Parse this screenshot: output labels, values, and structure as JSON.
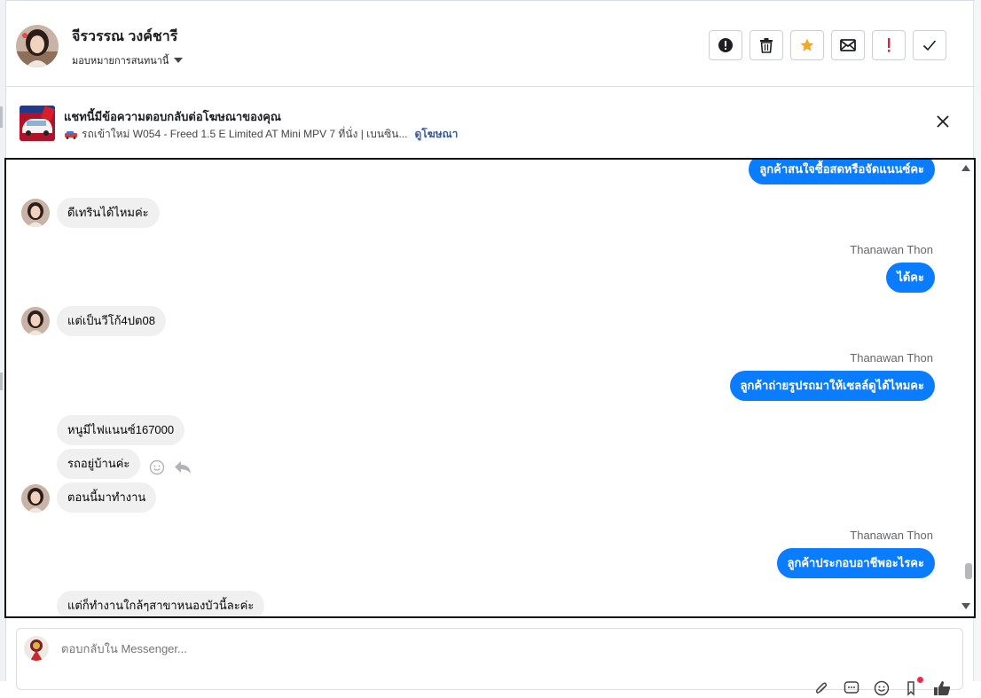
{
  "header": {
    "contact_name": "จีรวรรณ วงค์ชารี",
    "assign_label": "มอบหมายการสนทนานี้",
    "actions": [
      {
        "name": "spam-button",
        "icon": "exclamation-circle-icon"
      },
      {
        "name": "delete-button",
        "icon": "trash-icon"
      },
      {
        "name": "star-button",
        "icon": "star-icon"
      },
      {
        "name": "mark-unread-button",
        "icon": "envelope-icon"
      },
      {
        "name": "follow-up-button",
        "icon": "exclamation-icon"
      },
      {
        "name": "done-button",
        "icon": "check-icon"
      }
    ]
  },
  "ad": {
    "title": "แชทนี้มีข้อความตอบกลับต่อโฆษณาของคุณ",
    "subtitle": "รถเข้าใหม่ W054 - Freed 1.5 E Limited AT Mini MPV 7 ที่นั่ง | เบนซิน...",
    "link": "ดูโฆษณา"
  },
  "messages": [
    {
      "dir": "out",
      "text": "ลูกค้าสนใจซื้อสดหรือจัดแนนซ์คะ"
    },
    {
      "dir": "in",
      "text": "ดีเทรินได้ไหมค่ะ"
    },
    {
      "dir": "out",
      "sender": "Thanawan Thon",
      "text": "ได้คะ"
    },
    {
      "dir": "in",
      "text": "แต่เป็นวีโก้4ปต08"
    },
    {
      "dir": "out",
      "sender": "Thanawan Thon",
      "text": "ลูกค้าถ่ายรูปรถมาให้เซลล์ดูได้ไหมคะ"
    },
    {
      "dir": "in",
      "text": "หนูมีไฟแนนซ์167000"
    },
    {
      "dir": "in",
      "text": "รถอยู่บ้านค่ะ"
    },
    {
      "dir": "in",
      "text": "ตอนนี้มาทำงาน"
    },
    {
      "dir": "out",
      "sender": "Thanawan Thon",
      "text": "ลูกค้าประกอบอาชีพอะไรคะ"
    },
    {
      "dir": "in",
      "text": "แต่ก็ทำงานใกล้ๆสาขาหนองบัวนี้ละค่ะ"
    }
  ],
  "composer": {
    "placeholder": "ตอบกลับใน Messenger..."
  },
  "colors": {
    "outgoing_bubble": "#0a7cff",
    "incoming_bubble": "#f0f0f0",
    "link": "#385898",
    "star": "#f5a623",
    "alert": "#e41e3f"
  }
}
